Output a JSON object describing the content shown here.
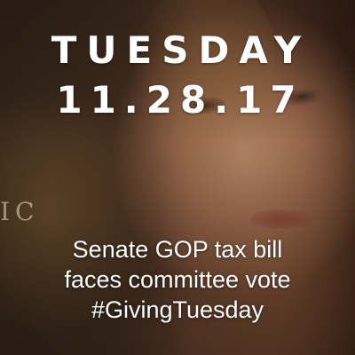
{
  "card": {
    "day": "TUESDAY",
    "date": "11.28.17",
    "background_letters": "IC",
    "headlines": [
      "Senate GOP tax bill",
      "faces committee vote",
      "#GivingTuesday"
    ],
    "colors": {
      "text": "#ffffff",
      "background": "#4a3322"
    }
  }
}
